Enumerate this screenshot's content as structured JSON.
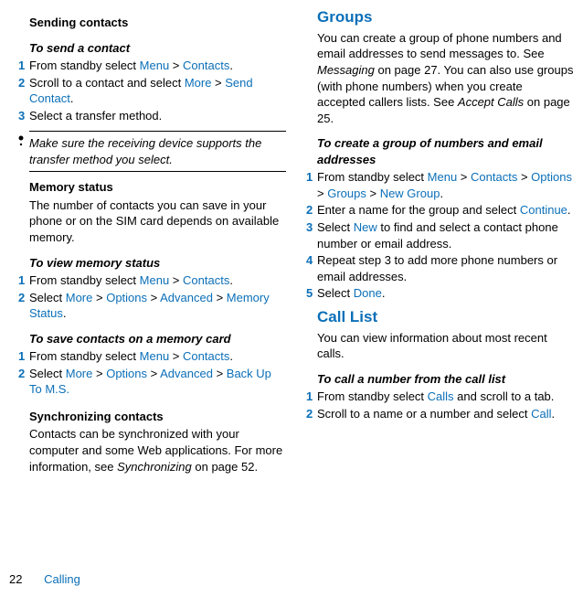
{
  "left": {
    "sending_heading": "Sending contacts",
    "send_contact_heading": "To send a contact",
    "send_steps": [
      {
        "num": "1",
        "pre": "From standby select ",
        "l1": "Menu",
        "sep1": " > ",
        "l2": "Contacts",
        "post": "."
      },
      {
        "num": "2",
        "pre": "Scroll to a contact and select ",
        "l1": "More",
        "sep1": " > ",
        "l2": "Send Contact",
        "post": "."
      },
      {
        "num": "3",
        "pre": "Select a transfer method.",
        "l1": "",
        "sep1": "",
        "l2": "",
        "post": ""
      }
    ],
    "note": "Make sure the receiving device supports the transfer method you select.",
    "memory_heading": "Memory status",
    "memory_para": "The number of contacts you can save in your phone or on the SIM card depends on available memory.",
    "view_memory_heading": "To view memory status",
    "view_memory_steps": [
      {
        "num": "1",
        "pre": "From standby select ",
        "l1": "Menu",
        "sep1": " > ",
        "l2": "Contacts",
        "post": "."
      },
      {
        "num": "2",
        "pre": "Select ",
        "l1": "More",
        "sep1": " > ",
        "l2": "Options",
        "sep2": " > ",
        "l3": "Advanced",
        "sep3": " > ",
        "l4": "Memory Status",
        "post": "."
      }
    ],
    "save_card_heading": "To save contacts on a memory card",
    "save_card_steps": [
      {
        "num": "1",
        "pre": "From standby select ",
        "l1": "Menu",
        "sep1": " > ",
        "l2": "Contacts",
        "post": "."
      },
      {
        "num": "2",
        "pre": "Select ",
        "l1": "More",
        "sep1": " > ",
        "l2": "Options",
        "sep2": " > ",
        "l3": "Advanced",
        "sep3": " > ",
        "l4": "Back Up To M.S.",
        "post": ""
      }
    ],
    "sync_heading": "Synchronizing contacts",
    "sync_para_pre": "Contacts can be synchronized with your computer and some Web applications. For more information, see ",
    "sync_para_em": "Synchronizing",
    "sync_para_post": " on page 52."
  },
  "right": {
    "groups_title": "Groups",
    "groups_para_pre": "You can create a group of phone numbers and email addresses to send messages to. See ",
    "groups_para_em1": "Messaging",
    "groups_para_mid": " on page 27. You can also use groups (with phone numbers) when you create accepted callers lists. See ",
    "groups_para_em2": "Accept Calls",
    "groups_para_post": " on page 25.",
    "create_group_heading": "To create a group of numbers and email addresses",
    "create_steps": {
      "s1": {
        "num": "1",
        "pre": "From standby select ",
        "l1": "Menu",
        "l2": "Contacts",
        "l3": "Options",
        "l4": "Groups",
        "l5": "New Group"
      },
      "s2": {
        "num": "2",
        "pre": "Enter a name for the group and select ",
        "l1": "Continue"
      },
      "s3": {
        "num": "3",
        "pre": "Select ",
        "l1": "New",
        "post": " to find and select a contact phone number or email address."
      },
      "s4": {
        "num": "4",
        "pre": "Repeat step 3 to add more phone numbers or email addresses."
      },
      "s5": {
        "num": "5",
        "pre": "Select ",
        "l1": "Done"
      }
    },
    "calllist_title": "Call List",
    "calllist_para": "You can view information about most recent calls.",
    "call_heading": "To call a number from the call list",
    "call_steps": {
      "s1": {
        "num": "1",
        "pre": "From standby select ",
        "l1": "Calls",
        "post": " and scroll to a tab."
      },
      "s2": {
        "num": "2",
        "pre": "Scroll to a name or a number and select ",
        "l1": "Call"
      }
    }
  },
  "footer": {
    "page": "22",
    "label": "Calling"
  }
}
